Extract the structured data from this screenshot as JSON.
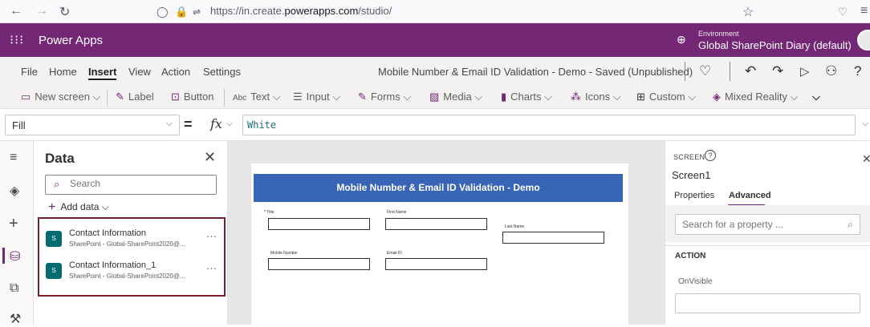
{
  "browser": {
    "url_prefix": "https://in.create.",
    "url_domain": "powerapps.com",
    "url_path": "/studio/"
  },
  "app": {
    "name": "Power Apps",
    "environment_label": "Environment",
    "environment_name": "Global SharePoint Diary (default)"
  },
  "menu": {
    "items": [
      "File",
      "Home",
      "Insert",
      "View",
      "Action",
      "Settings"
    ],
    "active": "Insert",
    "document_title": "Mobile Number & Email ID Validation - Demo - Saved (Unpublished)"
  },
  "ribbon": {
    "new_screen": "New screen",
    "label": "Label",
    "button": "Button",
    "text": "Text",
    "input": "Input",
    "forms": "Forms",
    "media": "Media",
    "charts": "Charts",
    "icons": "Icons",
    "custom": "Custom",
    "mixed_reality": "Mixed Reality"
  },
  "formula_bar": {
    "property": "Fill",
    "equals": "=",
    "fx": "fx",
    "formula": "White"
  },
  "data_panel": {
    "title": "Data",
    "search_placeholder": "Search",
    "add_data": "Add data",
    "sources": [
      {
        "name": "Contact Information",
        "subtitle": "SharePoint - Global-SharePoint2020@..."
      },
      {
        "name": "Contact Information_1",
        "subtitle": "SharePoint - Global-SharePoint2020@..."
      }
    ]
  },
  "canvas": {
    "form_title": "Mobile Number & Email ID Validation - Demo",
    "fields": {
      "title": "* Title",
      "first_name": "First Name",
      "last_name": "Last Name",
      "mobile_number": "Mobile Number",
      "email_id": "Email ID"
    }
  },
  "properties_panel": {
    "kind": "SCREEN",
    "name": "Screen1",
    "tabs": [
      "Properties",
      "Advanced"
    ],
    "active_tab": "Advanced",
    "search_placeholder": "Search for a property ...",
    "section": "ACTION",
    "property": "OnVisible"
  },
  "colors": {
    "brand": "#742774",
    "form_header": "#3965b6",
    "highlight_border": "#7a1c2c"
  }
}
